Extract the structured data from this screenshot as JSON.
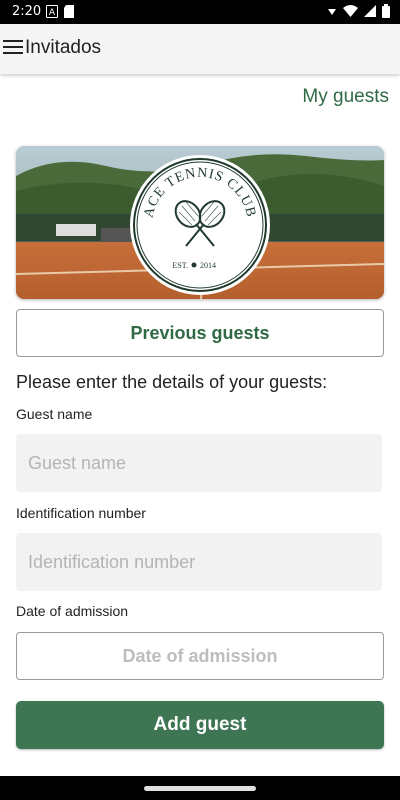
{
  "status_bar": {
    "time": "2:20"
  },
  "app_bar": {
    "title": "Invitados"
  },
  "links": {
    "my_guests": "My guests"
  },
  "banner": {
    "club_name": "ACE TENNIS CLUB",
    "est": "EST.",
    "year": "2014"
  },
  "buttons": {
    "previous_guests": "Previous guests",
    "add_guest": "Add guest",
    "date_of_admission": "Date of admission"
  },
  "form": {
    "intro": "Please enter the details of your guests:",
    "guest_name_label": "Guest name",
    "guest_name_placeholder": "Guest name",
    "id_label": "Identification number",
    "id_placeholder": "Identification number",
    "date_label": "Date of admission"
  },
  "colors": {
    "accent": "#2f6a45",
    "button": "#3e7553"
  }
}
